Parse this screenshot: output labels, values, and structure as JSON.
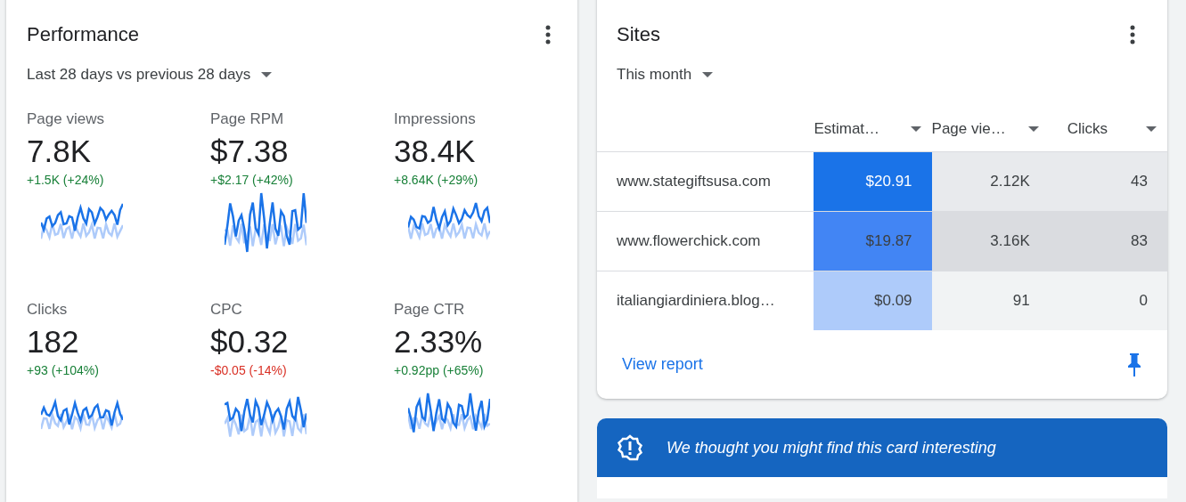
{
  "performance": {
    "title": "Performance",
    "period": "Last 28 days vs previous 28 days",
    "metrics": [
      {
        "label": "Page views",
        "value": "7.8K",
        "change": "+1.5K (+24%)",
        "color": "#188038"
      },
      {
        "label": "Page RPM",
        "value": "$7.38",
        "change": "+$2.17 (+42%)",
        "color": "#188038"
      },
      {
        "label": "Impressions",
        "value": "38.4K",
        "change": "+8.64K (+29%)",
        "color": "#188038"
      },
      {
        "label": "Clicks",
        "value": "182",
        "change": "+93 (+104%)",
        "color": "#188038"
      },
      {
        "label": "CPC",
        "value": "$0.32",
        "change": "-$0.05 (-14%)",
        "color": "#d93025"
      },
      {
        "label": "Page CTR",
        "value": "2.33%",
        "change": "+0.92pp (+65%)",
        "color": "#188038"
      }
    ]
  },
  "sites": {
    "title": "Sites",
    "period": "This month",
    "columns": [
      "Estimat…",
      "Page vie…",
      "Clicks"
    ],
    "rows": [
      {
        "site": "www.stategiftsusa.com",
        "cells": [
          {
            "text": "$20.91",
            "color": "#1a73e8"
          },
          {
            "text": "2.12K",
            "color": "#e8eaed"
          },
          {
            "text": "43",
            "color": "#e8eaed"
          }
        ]
      },
      {
        "site": "www.flowerchick.com",
        "cells": [
          {
            "text": "$19.87",
            "color": "#4285f4"
          },
          {
            "text": "3.16K",
            "color": "#dadce0"
          },
          {
            "text": "83",
            "color": "#dadce0"
          }
        ]
      },
      {
        "site": "italiangiardiniera.blog…",
        "cells": [
          {
            "text": "$0.09",
            "color": "#aecbfa"
          },
          {
            "text": "91",
            "color": "#f1f3f4"
          },
          {
            "text": "0",
            "color": "#f1f3f4"
          }
        ]
      }
    ],
    "link": "View report"
  },
  "banner": {
    "text": "We thought you might find this card interesting"
  }
}
